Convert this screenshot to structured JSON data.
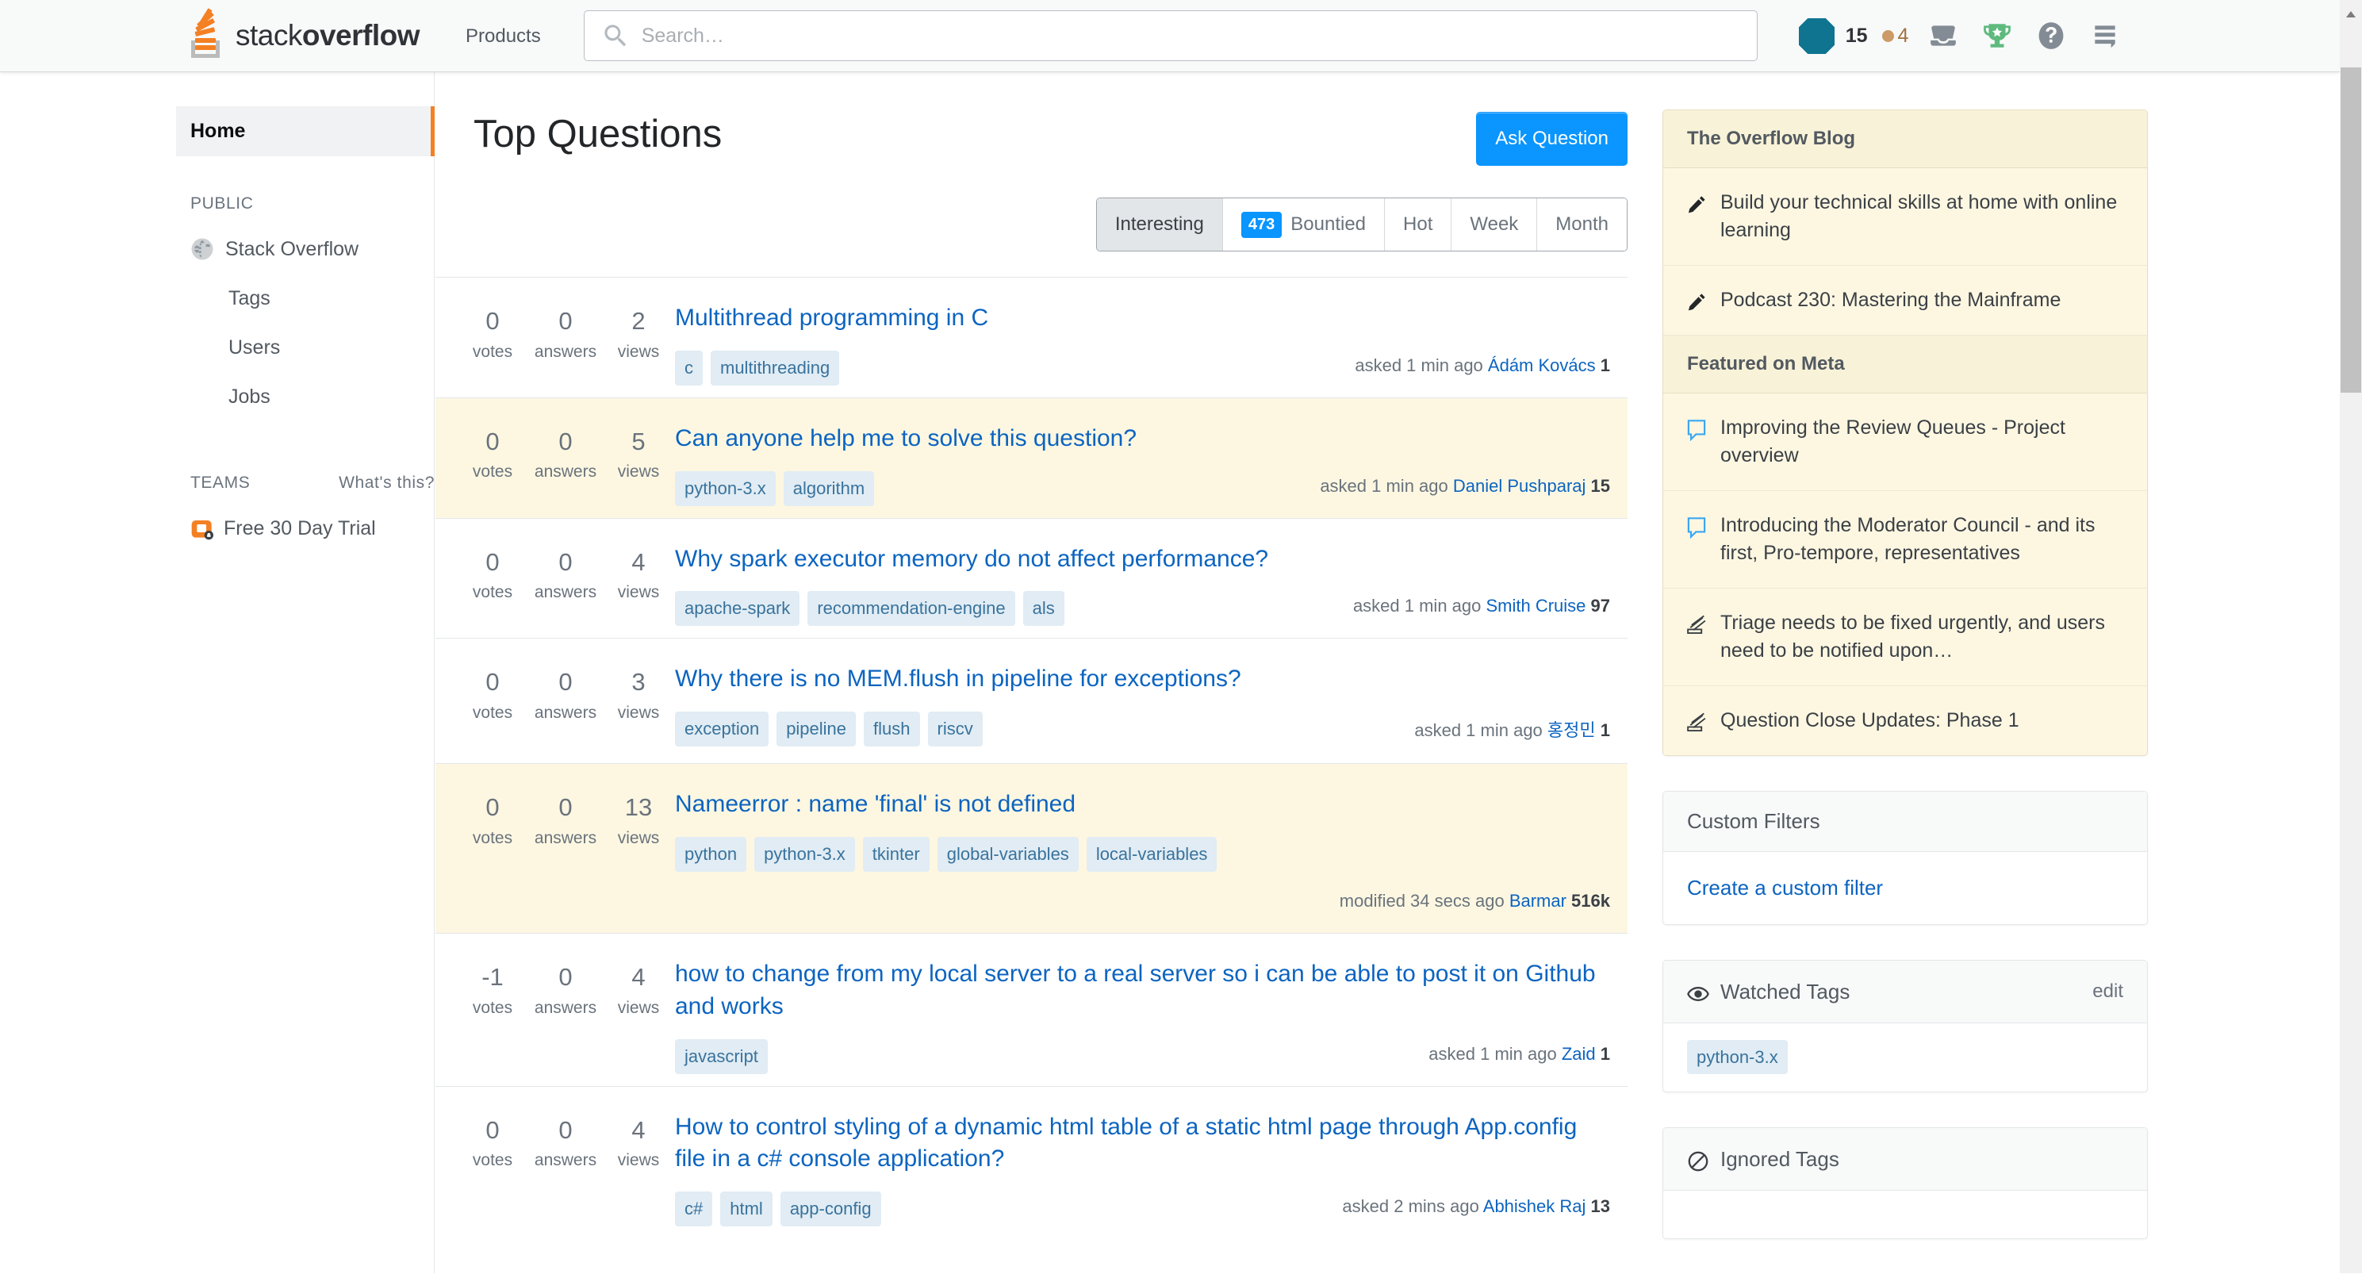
{
  "header": {
    "logo_text_light": "stack",
    "logo_text_bold": "overflow",
    "products_label": "Products",
    "search_placeholder": "Search…",
    "search_value": "",
    "reputation": "15",
    "bronze_badge_count": "4",
    "icons": [
      "inbox-icon",
      "trophy-icon",
      "help-icon",
      "hamburger-icon"
    ]
  },
  "sidebar": {
    "home_label": "Home",
    "public_label": "PUBLIC",
    "public_items": [
      {
        "label": "Stack Overflow",
        "icon": "globe-icon"
      },
      {
        "label": "Tags",
        "icon": ""
      },
      {
        "label": "Users",
        "icon": ""
      },
      {
        "label": "Jobs",
        "icon": ""
      }
    ],
    "teams_label": "TEAMS",
    "whats_this_label": "What's this?",
    "teams_item": "Free 30 Day Trial"
  },
  "main": {
    "title": "Top Questions",
    "ask_button": "Ask Question",
    "tabs": [
      {
        "label": "Interesting",
        "count": "",
        "active": true
      },
      {
        "label": "Bountied",
        "count": "473",
        "active": false
      },
      {
        "label": "Hot",
        "count": "",
        "active": false
      },
      {
        "label": "Week",
        "count": "",
        "active": false
      },
      {
        "label": "Month",
        "count": "",
        "active": false
      }
    ],
    "stat_labels": {
      "votes": "votes",
      "answers": "answers",
      "views": "views"
    },
    "questions": [
      {
        "votes": "0",
        "answers": "0",
        "views": "2",
        "title": "Multithread programming in C",
        "tags": [
          "c",
          "multithreading"
        ],
        "action": "asked 1 min ago",
        "user": "Ádám Kovács",
        "user_rep": "1",
        "highlighted": false,
        "meta_below": false
      },
      {
        "votes": "0",
        "answers": "0",
        "views": "5",
        "title": "Can anyone help me to solve this question?",
        "tags": [
          "python-3.x",
          "algorithm"
        ],
        "action": "asked 1 min ago",
        "user": "Daniel Pushparaj",
        "user_rep": "15",
        "highlighted": true,
        "meta_below": false
      },
      {
        "votes": "0",
        "answers": "0",
        "views": "4",
        "title": "Why spark executor memory do not affect performance?",
        "tags": [
          "apache-spark",
          "recommendation-engine",
          "als"
        ],
        "action": "asked 1 min ago",
        "user": "Smith Cruise",
        "user_rep": "97",
        "highlighted": false,
        "meta_below": false
      },
      {
        "votes": "0",
        "answers": "0",
        "views": "3",
        "title": "Why there is no MEM.flush in pipeline for exceptions?",
        "tags": [
          "exception",
          "pipeline",
          "flush",
          "riscv"
        ],
        "action": "asked 1 min ago",
        "user": "홍정민",
        "user_rep": "1",
        "highlighted": false,
        "meta_below": false
      },
      {
        "votes": "0",
        "answers": "0",
        "views": "13",
        "title": "Nameerror : name 'final' is not defined",
        "tags": [
          "python",
          "python-3.x",
          "tkinter",
          "global-variables",
          "local-variables"
        ],
        "action": "modified 34 secs ago",
        "user": "Barmar",
        "user_rep": "516k",
        "highlighted": true,
        "meta_below": true
      },
      {
        "votes": "-1",
        "answers": "0",
        "views": "4",
        "title": "how to change from my local server to a real server so i can be able to post it on Github and works",
        "tags": [
          "javascript"
        ],
        "action": "asked 1 min ago",
        "user": "Zaid",
        "user_rep": "1",
        "highlighted": false,
        "meta_below": false
      },
      {
        "votes": "0",
        "answers": "0",
        "views": "4",
        "title": "How to control styling of a dynamic html table of a static html page through App.config file in a c# console application?",
        "tags": [
          "c#",
          "html",
          "app-config"
        ],
        "action": "asked 2 mins ago",
        "user": "Abhishek Raj",
        "user_rep": "13",
        "highlighted": false,
        "meta_below": false
      }
    ]
  },
  "rightcol": {
    "blog_title": "The Overflow Blog",
    "blog_items": [
      {
        "text": "Build your technical skills at home with online learning",
        "icon": "pencil-icon"
      },
      {
        "text": "Podcast 230: Mastering the Mainframe",
        "icon": "pencil-icon"
      }
    ],
    "meta_title": "Featured on Meta",
    "meta_items": [
      {
        "text": "Improving the Review Queues - Project overview",
        "icon": "speech-bubble-icon"
      },
      {
        "text": "Introducing the Moderator Council - and its first, Pro-tempore, representatives",
        "icon": "speech-bubble-icon"
      },
      {
        "text": "Triage needs to be fixed urgently, and users need to be notified upon…",
        "icon": "announcement-icon"
      },
      {
        "text": "Question Close Updates: Phase 1",
        "icon": "announcement-icon"
      }
    ],
    "custom_filters_title": "Custom Filters",
    "create_filter_label": "Create a custom filter",
    "watched_tags_title": "Watched Tags",
    "watched_tags_edit": "edit",
    "watched_tags": [
      "python-3.x"
    ],
    "ignored_tags_title": "Ignored Tags"
  }
}
